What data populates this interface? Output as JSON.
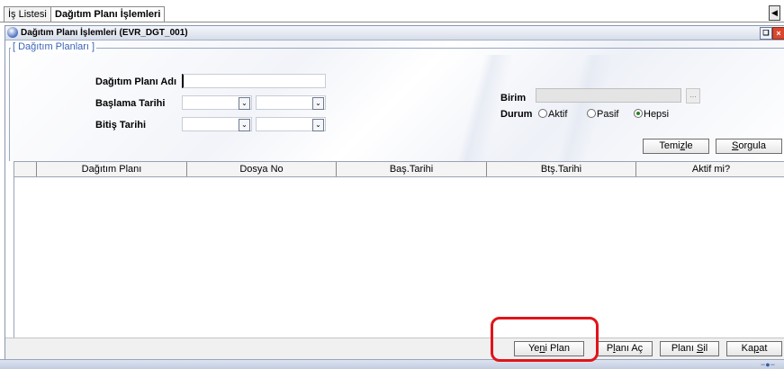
{
  "tabs": [
    {
      "label": "İş Listesi",
      "active": false
    },
    {
      "label": "Dağıtım Planı İşlemleri",
      "active": true
    }
  ],
  "window": {
    "title": "Dağıtım Planı İşlemleri (EVR_DGT_001)"
  },
  "form": {
    "legend": "[ Dağıtım Planları ]",
    "plan_name_label": "Dağıtım Planı Adı",
    "plan_name_value": "",
    "start_date_label": "Başlama Tarihi",
    "end_date_label": "Bitiş Tarihi",
    "unit_label": "Birim",
    "unit_value": "",
    "unit_button": "...",
    "status_label": "Durum",
    "status_options": [
      {
        "label": "Aktif",
        "selected": false
      },
      {
        "label": "Pasif",
        "selected": false
      },
      {
        "label": "Hepsi",
        "selected": true
      }
    ],
    "clear_button": {
      "pre": "Temi",
      "u": "z",
      "post": "le"
    },
    "query_button": {
      "pre": "",
      "u": "S",
      "post": "orgula"
    }
  },
  "grid": {
    "columns": [
      "Dağıtım Planı",
      "Dosya No",
      "Baş.Tarihi",
      "Btş.Tarihi",
      "Aktif mi?"
    ],
    "rows": []
  },
  "actions": {
    "new_plan": {
      "pre": "Ye",
      "u": "n",
      "post": "i Plan"
    },
    "open_plan": {
      "pre": "P",
      "u": "l",
      "post": "anı Aç"
    },
    "delete_plan": {
      "pre": "Planı ",
      "u": "S",
      "post": "il"
    },
    "close": {
      "pre": "Ka",
      "u": "p",
      "post": "at"
    }
  },
  "colors": {
    "accent": "#3b63b7",
    "highlight": "#e0141a",
    "radio_selected": "#2d7d2d"
  }
}
